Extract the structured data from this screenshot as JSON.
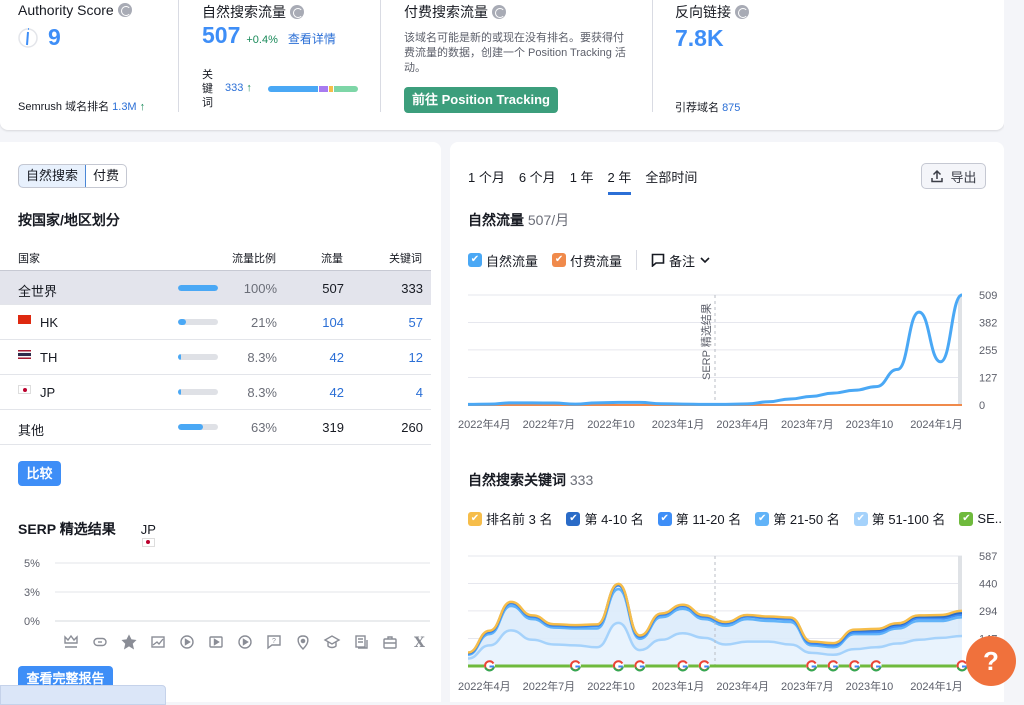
{
  "metrics": {
    "authority": {
      "title": "Authority Score",
      "value": "9",
      "rank_label": "Semrush 域名排名",
      "rank_value": "1.3M",
      "rank_trend": "↑"
    },
    "organic": {
      "title": "自然搜索流量",
      "value": "507",
      "change": "+0.4%",
      "details_link": "查看详情",
      "keywords_label": "关键词",
      "keywords_value": "333",
      "keywords_trend": "↑",
      "keyword_distribution": [
        {
          "color": "#4aa8f5",
          "share": 0.58
        },
        {
          "color": "#a87bf0",
          "share": 0.1
        },
        {
          "color": "#f6bd4a",
          "share": 0.04
        },
        {
          "color": "#7ed6a7",
          "share": 0.28
        }
      ]
    },
    "paid": {
      "title": "付费搜索流量",
      "description": "该域名可能是新的或现在没有排名。要获得付费流量的数据，创建一个 Position Tracking 活动。",
      "button": "前往 Position Tracking"
    },
    "backlinks": {
      "title": "反向链接",
      "value": "7.8K",
      "ref_label": "引荐域名",
      "ref_value": "875"
    }
  },
  "left": {
    "segment": {
      "options": [
        "自然搜索",
        "付费"
      ],
      "selected": "自然搜索"
    },
    "title": "按国家/地区划分",
    "columns": [
      "国家",
      "流量比例",
      "流量",
      "关键词"
    ],
    "rows": [
      {
        "name": "全世界",
        "flag": "",
        "share": 1.0,
        "share_label": "100%",
        "traffic": "507",
        "keywords": "333",
        "linked": false,
        "selected": true
      },
      {
        "name": "HK",
        "flag": "hk",
        "share": 0.21,
        "share_label": "21%",
        "traffic": "104",
        "keywords": "57",
        "linked": true
      },
      {
        "name": "TH",
        "flag": "th",
        "share": 0.083,
        "share_label": "8.3%",
        "traffic": "42",
        "keywords": "12",
        "linked": true
      },
      {
        "name": "JP",
        "flag": "jp",
        "share": 0.083,
        "share_label": "8.3%",
        "traffic": "42",
        "keywords": "4",
        "linked": true
      },
      {
        "name": "其他",
        "flag": "",
        "share": 0.63,
        "share_label": "63%",
        "traffic": "319",
        "keywords": "260",
        "linked": false
      }
    ],
    "compare_button": "比较",
    "serp": {
      "title": "SERP 精选结果",
      "country": "JP",
      "yticks": [
        "5%",
        "3%",
        "0%"
      ],
      "icons": [
        "crown-icon",
        "link-icon",
        "star-icon",
        "image-icon",
        "video-icon",
        "video-box-icon",
        "play-icon",
        "faq-icon",
        "location-icon",
        "education-icon",
        "news-icon",
        "jobs-icon",
        "x-icon"
      ]
    },
    "full_report_button": "查看完整报告"
  },
  "right": {
    "tabs": [
      "1 个月",
      "6 个月",
      "1 年",
      "2 年",
      "全部时间"
    ],
    "active_tab": "2 年",
    "export_button": "导出",
    "traffic_title": "自然流量",
    "traffic_value": "507/月",
    "traffic_legend": [
      {
        "label": "自然流量",
        "color": "#4aa8f5"
      },
      {
        "label": "付费流量",
        "color": "#f08a4b"
      }
    ],
    "notes_label": "备注",
    "keywords_title": "自然搜索关键词",
    "keywords_value": "333",
    "keywords_legend": [
      {
        "label": "排名前 3 名",
        "color": "#f6bd4a"
      },
      {
        "label": "第 4-10 名",
        "color": "#2a6bc7"
      },
      {
        "label": "第 11-20 名",
        "color": "#3e8ef7"
      },
      {
        "label": "第 21-50 名",
        "color": "#61b3f8"
      },
      {
        "label": "第 51-100 名",
        "color": "#a5d2fb"
      },
      {
        "label": "SE..",
        "color": "#6fba3d"
      }
    ]
  },
  "chart_data": [
    {
      "type": "line",
      "title": "自然流量 507/月",
      "annotation": "SERP 精选结果",
      "x": [
        "2022年3月",
        "2022年4月",
        "2022年5月",
        "2022年6月",
        "2022年7月",
        "2022年8月",
        "2022年9月",
        "2022年10月",
        "2022年11月",
        "2022年12月",
        "2023年1月",
        "2023年2月",
        "2023年3月",
        "2023年4月",
        "2023年5月",
        "2023年6月",
        "2023年7月",
        "2023年8月",
        "2023年9月",
        "2023年10月",
        "2023年11月",
        "2023年12月",
        "2024年1月",
        "2024年2月"
      ],
      "xticks": [
        "2022年4月",
        "2022年7月",
        "2022年10",
        "2023年1月",
        "2023年4月",
        "2023年7月",
        "2023年10",
        "2024年1月"
      ],
      "yticks": [
        0,
        127,
        255,
        382,
        509
      ],
      "ylim": [
        0,
        509
      ],
      "series": [
        {
          "name": "自然流量",
          "color": "#4aa8f5",
          "values": [
            3,
            4,
            10,
            10,
            9,
            4,
            10,
            12,
            12,
            6,
            4,
            3,
            3,
            5,
            15,
            28,
            40,
            55,
            68,
            85,
            165,
            430,
            200,
            509
          ]
        },
        {
          "name": "付费流量",
          "color": "#f08a4b",
          "values": [
            0,
            0,
            0,
            0,
            0,
            0,
            0,
            0,
            0,
            0,
            0,
            0,
            0,
            0,
            0,
            0,
            0,
            0,
            0,
            0,
            0,
            0,
            0,
            0
          ]
        }
      ]
    },
    {
      "type": "area",
      "title": "自然搜索关键词 333",
      "x": [
        "2022年3月",
        "2022年4月",
        "2022年5月",
        "2022年6月",
        "2022年7月",
        "2022年8月",
        "2022年9月",
        "2022年10月",
        "2022年11月",
        "2022年12月",
        "2023年1月",
        "2023年2月",
        "2023年3月",
        "2023年4月",
        "2023年5月",
        "2023年6月",
        "2023年7月",
        "2023年8月",
        "2023年9月",
        "2023年10月",
        "2023年11月",
        "2023年12月",
        "2024年1月",
        "2024年2月"
      ],
      "xticks": [
        "2022年4月",
        "2022年7月",
        "2022年10",
        "2023年1月",
        "2023年4月",
        "2023年7月",
        "2023年10",
        "2024年1月"
      ],
      "yticks": [
        0,
        147,
        294,
        440,
        587
      ],
      "ylim": [
        0,
        587
      ],
      "series": [
        {
          "name": "排名前 3 名",
          "values": [
            2,
            2,
            2,
            2,
            2,
            2,
            2,
            2,
            2,
            2,
            2,
            2,
            2,
            2,
            2,
            2,
            2,
            2,
            4,
            6,
            6,
            6,
            8,
            10
          ]
        },
        {
          "name": "第 4-10 名",
          "values": [
            4,
            6,
            6,
            6,
            6,
            6,
            6,
            6,
            6,
            6,
            6,
            6,
            6,
            6,
            8,
            8,
            8,
            10,
            10,
            10,
            10,
            10,
            10,
            10
          ]
        },
        {
          "name": "第 11-20 名",
          "values": [
            6,
            10,
            14,
            12,
            10,
            10,
            14,
            20,
            10,
            12,
            14,
            12,
            12,
            14,
            14,
            14,
            10,
            10,
            10,
            12,
            12,
            14,
            14,
            14
          ]
        },
        {
          "name": "第 21-50 名",
          "values": [
            20,
            60,
            130,
            110,
            90,
            90,
            100,
            180,
            60,
            120,
            130,
            100,
            100,
            120,
            110,
            120,
            40,
            40,
            80,
            70,
            80,
            100,
            90,
            100
          ]
        },
        {
          "name": "第 51-100 名",
          "values": [
            40,
            110,
            190,
            140,
            115,
            110,
            100,
            230,
            85,
            140,
            175,
            150,
            115,
            130,
            130,
            115,
            70,
            60,
            90,
            100,
            120,
            140,
            150,
            160
          ]
        }
      ],
      "serp_markers": [
        "2022年4月",
        "2022年8月",
        "2022年10月",
        "2022年11月",
        "2023年1月",
        "2023年2月",
        "2023年7月",
        "2023年8月",
        "2023年9月",
        "2023年10月",
        "2024年2月"
      ]
    }
  ]
}
